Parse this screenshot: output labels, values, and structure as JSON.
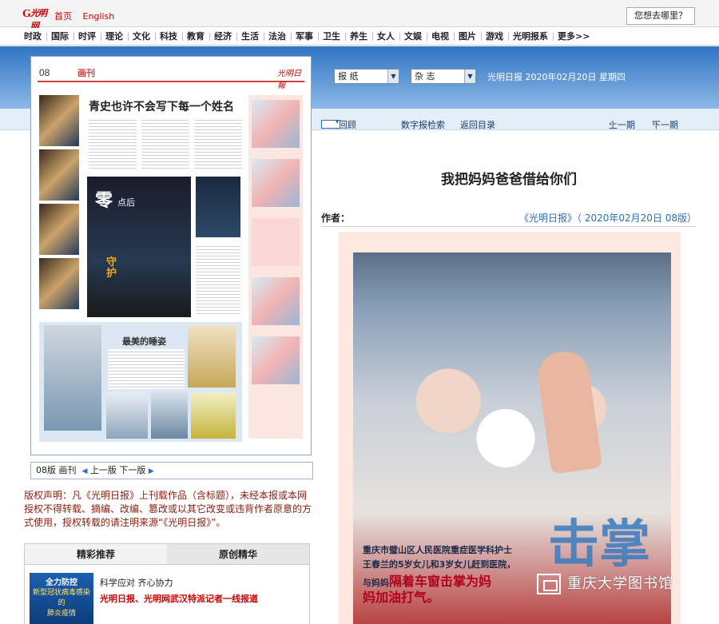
{
  "topbar": {
    "logo_text": "光明网",
    "links": [
      "首页",
      "English"
    ],
    "search_button": "您想去哪里？"
  },
  "nav": [
    "时政",
    "国际",
    "时评",
    "理论",
    "文化",
    "科技",
    "教育",
    "经济",
    "生活",
    "法治",
    "军事",
    "卫生",
    "养生",
    "女人",
    "文娱",
    "电视",
    "图片",
    "游戏",
    "光明报系",
    "更多>>"
  ],
  "selectors": {
    "paper": "报 纸",
    "magazine": "杂 志",
    "date_line": "光明日报 2020年02月20日 星期四"
  },
  "page_image": {
    "page_number": "08",
    "column": "画刊",
    "paper_logo": "光明日報",
    "headline": "青史也许不会写下每一个姓名",
    "poster_big": "零",
    "poster_small": "点后",
    "poster_guard": "守护",
    "lower_title": "最美的睡姿"
  },
  "page_bar": {
    "label": "08版 画刊",
    "prev": "上一版",
    "next": "下一版"
  },
  "copyright": "版权声明：凡《光明日报》上刊载作品（含标题），未经本报或本网授权不得转载、摘编、改编、篡改或以其它改变或违背作者原意的方式使用，授权转载的请注明来源“《光明日报》”。",
  "tabs": {
    "tab1": "精彩推荐",
    "tab2": "原创精华",
    "promo_line1": "全力防控",
    "promo_line2": "新型冠状病毒感染的",
    "promo_line3": "肺炎疫情",
    "item1": "科学应对 齐心协力",
    "item2": "光明日报、光明网武汉特派记者一线报道"
  },
  "toolbar": {
    "review": "往期回顾",
    "search": "数字报检索",
    "back": "返回目录",
    "prev_page": "上一期",
    "next_page": "下一期"
  },
  "article": {
    "title": "我把妈妈爸爸借给你们",
    "author_label": "作者：",
    "source": "《光明日报》（ 2020年02月20日 08版）"
  },
  "photo": {
    "caption1": "重庆市璧山区人民医院重症医学科护士",
    "caption2": "王春兰的5岁女儿和3岁女儿赶到医院，",
    "caption3_lead": "与妈妈",
    "caption3": "隔着车窗击掌为妈",
    "caption4": "妈加油打气。",
    "big_char": "击掌"
  },
  "watermark": "重庆大学图书馆"
}
